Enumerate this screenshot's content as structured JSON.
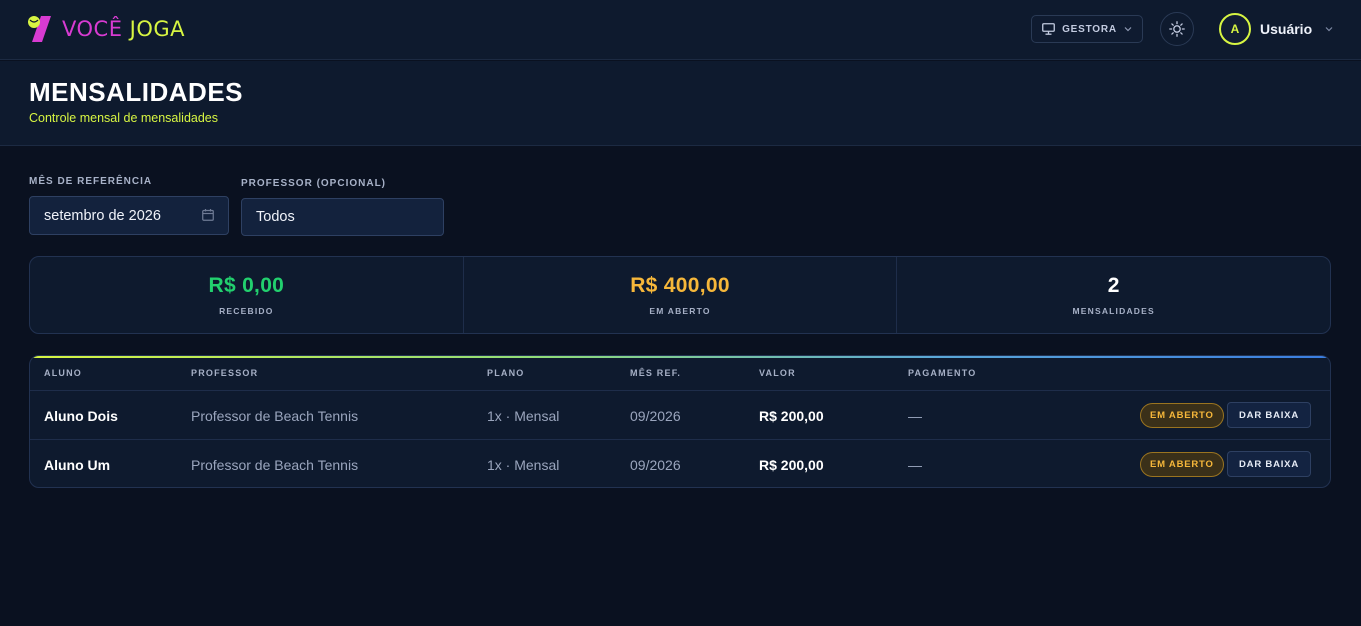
{
  "brand": {
    "word1": "VOCÊ",
    "word2": "JOGA",
    "accent": "#d7f542",
    "magenta": "#d83bd2"
  },
  "header": {
    "role_label": "GESTORA",
    "theme_icon": "sun-icon",
    "user": {
      "initial": "A",
      "name": "Usuário"
    }
  },
  "page": {
    "title": "MENSALIDADES",
    "subtitle": "Controle mensal de mensalidades"
  },
  "filters": {
    "month_label": "MÊS DE REFERÊNCIA",
    "month_value": "setembro de 2026",
    "teacher_label": "PROFESSOR (OPCIONAL)",
    "teacher_value": "Todos"
  },
  "stats": [
    {
      "value": "R$ 0,00",
      "label": "RECEBIDO",
      "color": "#22d06e"
    },
    {
      "value": "R$ 400,00",
      "label": "EM ABERTO",
      "color": "#f6b73a"
    },
    {
      "value": "2",
      "label": "MENSALIDADES",
      "color": "#ffffff"
    }
  ],
  "table": {
    "headers": {
      "aluno": "ALUNO",
      "professor": "PROFESSOR",
      "plano": "PLANO",
      "mes": "MÊS REF.",
      "valor": "VALOR",
      "pagamento": "PAGAMENTO"
    },
    "rows": [
      {
        "aluno": "Aluno Dois",
        "professor": "Professor de Beach Tennis",
        "plano": "1x · Mensal",
        "mes": "09/2026",
        "valor": "R$ 200,00",
        "pagamento": "—",
        "status": "EM ABERTO",
        "action": "DAR BAIXA"
      },
      {
        "aluno": "Aluno Um",
        "professor": "Professor de Beach Tennis",
        "plano": "1x · Mensal",
        "mes": "09/2026",
        "valor": "R$ 200,00",
        "pagamento": "—",
        "status": "EM ABERTO",
        "action": "DAR BAIXA"
      }
    ]
  }
}
